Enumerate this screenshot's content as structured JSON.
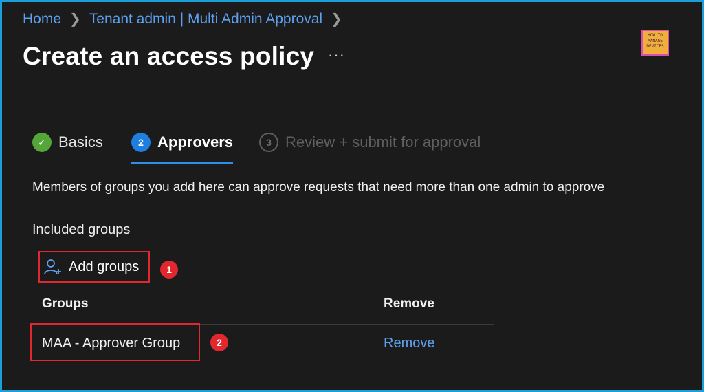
{
  "breadcrumb": {
    "items": [
      "Home",
      "Tenant admin | Multi Admin Approval"
    ]
  },
  "page": {
    "title": "Create an access policy",
    "more_label": "···"
  },
  "logo": {
    "lines": [
      "HOW TO",
      "MANAGE",
      "DEVICES"
    ]
  },
  "steps": [
    {
      "number": "✓",
      "label": "Basics",
      "state": "complete"
    },
    {
      "number": "2",
      "label": "Approvers",
      "state": "active"
    },
    {
      "number": "3",
      "label": "Review + submit for approval",
      "state": "disabled"
    }
  ],
  "description": "Members of groups you add here can approve requests that need more than one admin to approve",
  "included_groups": {
    "heading": "Included groups",
    "add_button_label": "Add groups",
    "columns": [
      "Groups",
      "Remove"
    ],
    "rows": [
      {
        "name": "MAA - Approver Group",
        "action": "Remove"
      }
    ]
  },
  "annotations": [
    "1",
    "2"
  ],
  "colors": {
    "accent": "#5ea0ef",
    "highlight": "#e0282e",
    "success": "#55a63a",
    "border": "#1a9fd9"
  }
}
